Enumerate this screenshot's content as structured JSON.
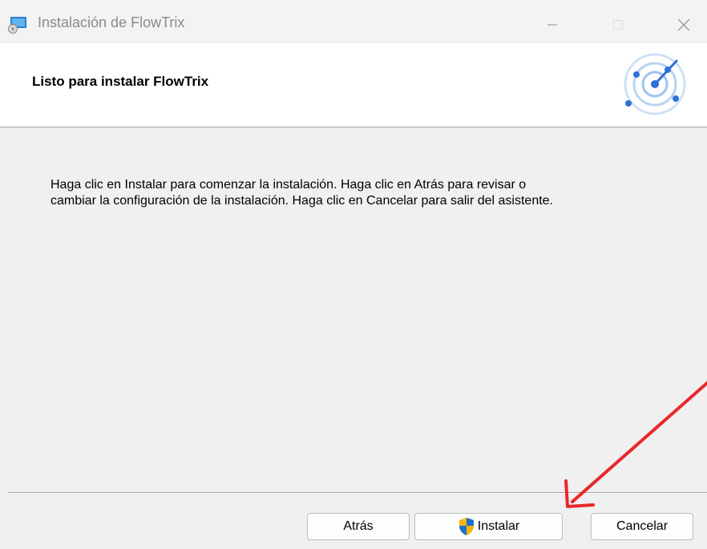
{
  "window": {
    "title": "Instalación de FlowTrix",
    "icons": {
      "app": "installer-app-icon",
      "minimize": "minimize-icon",
      "maximize": "maximize-icon",
      "close": "close-icon"
    }
  },
  "banner": {
    "title": "Listo para instalar FlowTrix",
    "logo_icon": "flowtrix-radar-logo-icon"
  },
  "body": {
    "line1": "Haga clic en Instalar para comenzar la instalación. Haga clic en Atrás para revisar o",
    "line2": "cambiar la configuración de la instalación. Haga clic en Cancelar para salir del asistente."
  },
  "buttons": {
    "back_label": "Atrás",
    "install_label": "Instalar",
    "install_icon": "uac-shield-icon",
    "cancel_label": "Cancelar"
  },
  "colors": {
    "window_bg": "#f0f0f0",
    "banner_bg": "#ffffff",
    "annotation_arrow": "#e8282b",
    "logo_accent": "#2f6fd6"
  }
}
